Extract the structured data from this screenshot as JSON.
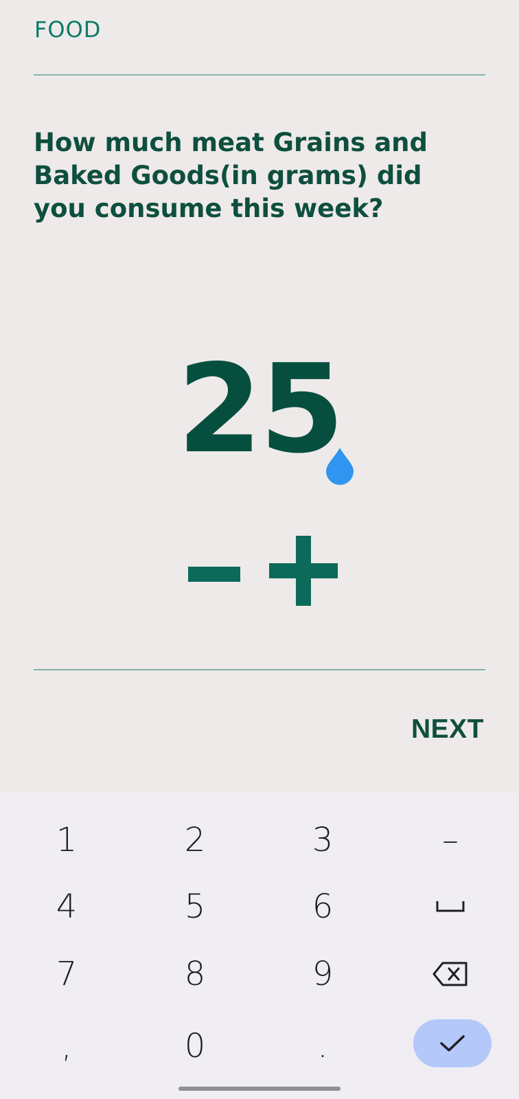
{
  "header": {
    "category": "FOOD"
  },
  "question": {
    "text": "How much meat Grains and Baked Goods(in grams) did you consume this week?"
  },
  "amount": {
    "value": "25"
  },
  "actions": {
    "next_label": "NEXT"
  },
  "colors": {
    "accent": "#0B6A59",
    "title": "#0E4F3F",
    "cursor": "#2F95F0",
    "enter_key": "#B4C8FA"
  },
  "keyboard": {
    "keys": {
      "k1": "1",
      "k2": "2",
      "k3": "3",
      "k4": "4",
      "k5": "5",
      "k6": "6",
      "k7": "7",
      "k8": "8",
      "k9": "9",
      "k0": "0",
      "comma": ",",
      "period": ".",
      "dash": "–"
    },
    "icons": {
      "space": "space-icon",
      "backspace": "backspace-icon",
      "enter": "checkmark-icon"
    }
  }
}
